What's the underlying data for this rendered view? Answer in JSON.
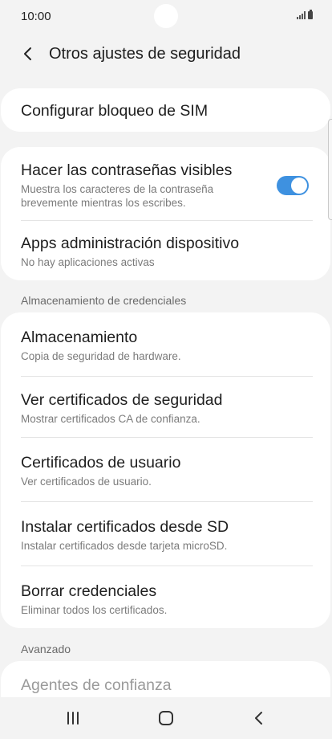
{
  "status_bar": {
    "time": "10:00"
  },
  "header": {
    "title": "Otros ajustes de seguridad"
  },
  "sim_card": {
    "title": "Configurar bloqueo de SIM"
  },
  "passwords_card": {
    "visible_passwords": {
      "title": "Hacer las contraseñas visibles",
      "subtitle_line1": "Muestra los caracteres de la contraseña",
      "subtitle_line2": "brevemente mientras los escribes.",
      "toggle_on": true
    },
    "device_admin": {
      "title": "Apps administración dispositivo",
      "subtitle": "No hay aplicaciones activas"
    }
  },
  "credentials": {
    "header": "Almacenamiento de credenciales",
    "items": [
      {
        "title": "Almacenamiento",
        "subtitle": "Copia de seguridad de hardware."
      },
      {
        "title": "Ver certificados de seguridad",
        "subtitle": "Mostrar certificados CA de confianza."
      },
      {
        "title": "Certificados de usuario",
        "subtitle": "Ver certificados de usuario."
      },
      {
        "title": "Instalar certificados desde SD",
        "subtitle": "Instalar certificados desde tarjeta microSD."
      },
      {
        "title": "Borrar credenciales",
        "subtitle": "Eliminar todos los certificados."
      }
    ]
  },
  "advanced": {
    "header": "Avanzado",
    "items": [
      {
        "title": "Agentes de confianza"
      }
    ]
  },
  "colors": {
    "accent": "#3e91e0",
    "background": "#f3f3f3",
    "card": "#ffffff"
  },
  "nav_bar": {
    "icons": [
      "recent-apps-icon",
      "home-icon",
      "back-icon"
    ]
  }
}
